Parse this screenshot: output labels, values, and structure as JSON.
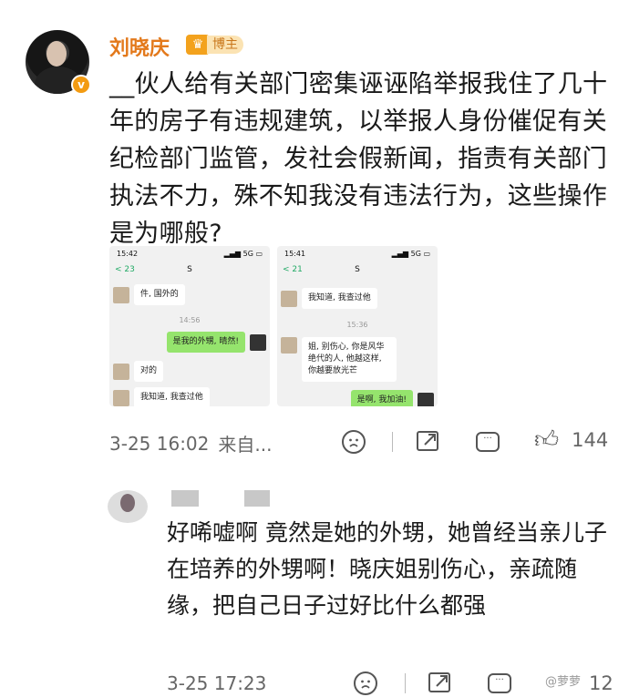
{
  "post": {
    "username": "刘晓庆",
    "badge_label": "博主",
    "verified_mark": "v",
    "text": "__伙人给有关部门密集诬诬陷举报我住了几十年的房子有违规建筑，以举报人身份催促有关纪检部门监管，发社会假新闻，指责有关部门执法不力，殊不知我没有违法行为，这些操作是为哪般?",
    "timestamp": "3-25 16:02",
    "source": "来自...",
    "like_count": "144"
  },
  "screenshots": [
    {
      "time": "15:42",
      "back_count": "< 23",
      "contact": "S",
      "messages": [
        {
          "side": "left",
          "text": "件, 国外的"
        },
        {
          "type": "time",
          "text": "14:56"
        },
        {
          "side": "right",
          "text": "是我的外甥, 晴然!"
        },
        {
          "side": "left",
          "text": "对的"
        },
        {
          "side": "left",
          "text": "我知道, 我查过他"
        }
      ]
    },
    {
      "time": "15:41",
      "back_count": "< 21",
      "contact": "S",
      "messages": [
        {
          "side": "left",
          "text": "我知道, 我查过他"
        },
        {
          "type": "time",
          "text": "15:36"
        },
        {
          "side": "left",
          "text": "姐, 别伤心, 你是风华绝代的人, 他越这样, 你越要放光芒"
        },
        {
          "side": "right",
          "text": "是啊, 我加油!"
        }
      ]
    }
  ],
  "reply": {
    "text": "好唏嘘啊 竟然是她的外甥，她曾经当亲儿子在培养的外甥啊！晓庆姐别伤心，亲疏随缘，把自己日子过好比什么都强",
    "timestamp": "3-25 17:23",
    "like_count": "12"
  },
  "watermark": "@萝萝"
}
